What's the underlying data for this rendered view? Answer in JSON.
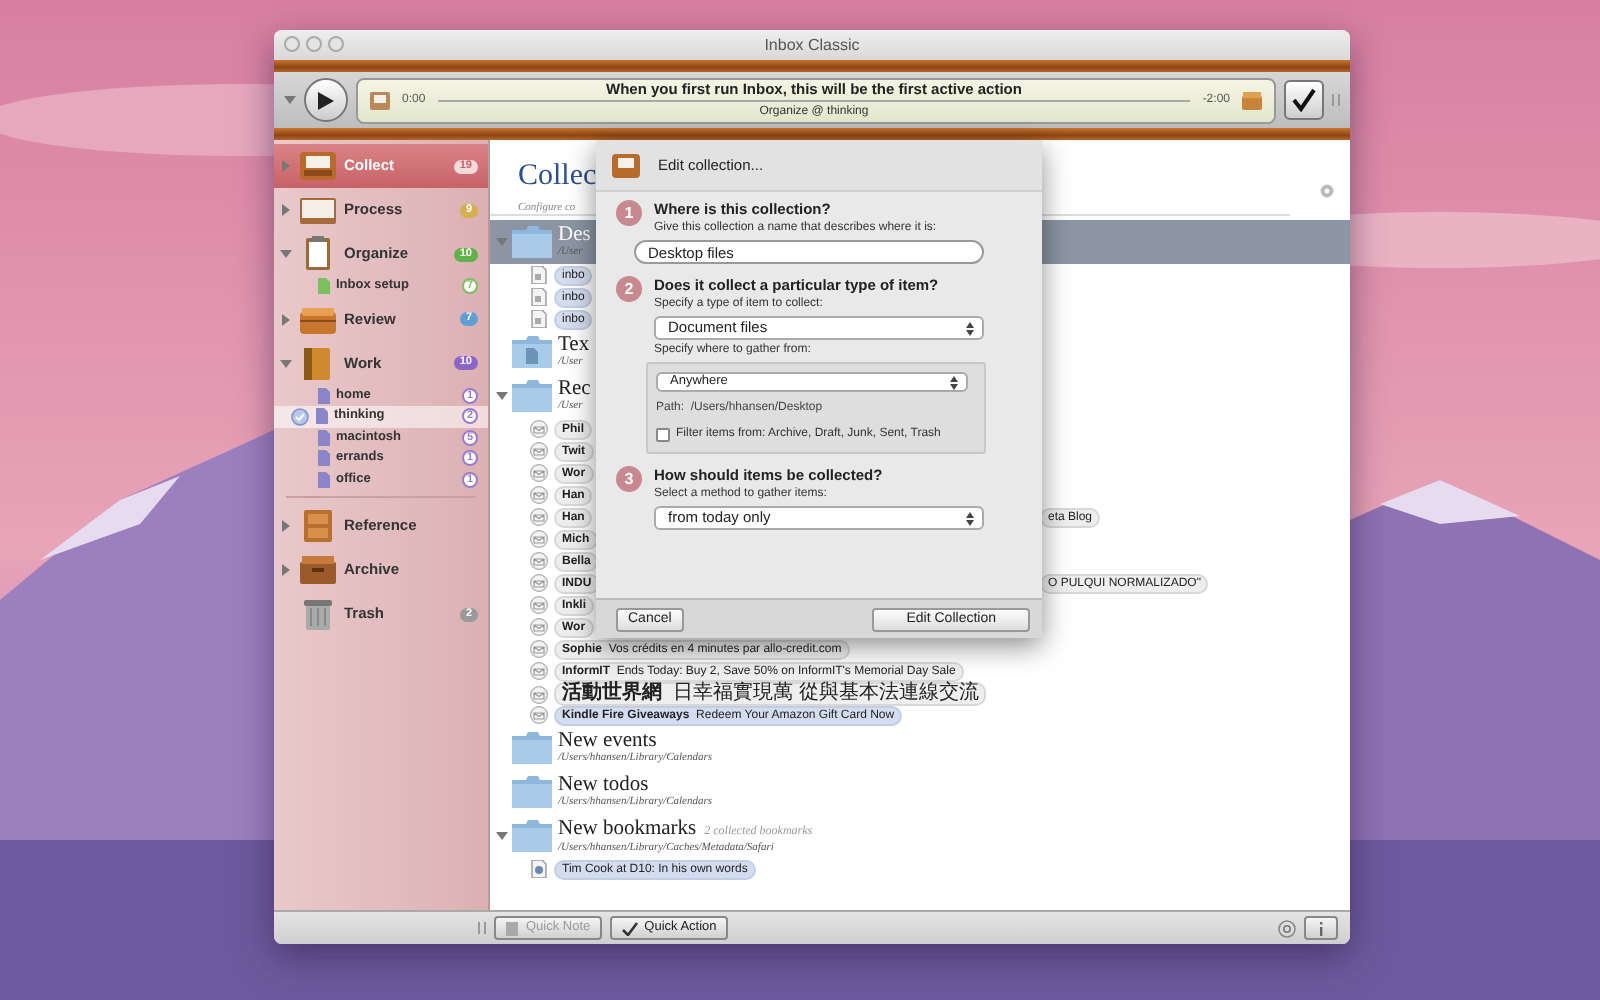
{
  "window": {
    "title": "Inbox Classic"
  },
  "player": {
    "elapsed": "0:00",
    "action": "When you first run Inbox, this will be the first active action",
    "context": "Organize @ thinking",
    "remaining": "-2:00"
  },
  "sidebar": {
    "items": [
      {
        "kind": "tray",
        "label": "Collect",
        "count": "19",
        "color": "#f4dada",
        "selected": true,
        "expanded": false
      },
      {
        "kind": "box",
        "label": "Process",
        "count": "9",
        "color": "#d4b04e",
        "selected": false,
        "expanded": false
      },
      {
        "kind": "clipboard",
        "label": "Organize",
        "count": "10",
        "color": "#62b04a",
        "selected": false,
        "expanded": true,
        "children": [
          {
            "label": "Inbox setup",
            "count": "7",
            "color": "#7cbf5e",
            "selected": false
          }
        ]
      },
      {
        "kind": "basket",
        "label": "Review",
        "count": "7",
        "color": "#5f9fd4",
        "selected": false,
        "expanded": false
      },
      {
        "kind": "binder",
        "label": "Work",
        "count": "10",
        "color": "#8a67c6",
        "selected": false,
        "expanded": true,
        "children": [
          {
            "label": "home",
            "count": "1",
            "color": "#9a7ccc",
            "selected": false
          },
          {
            "label": "thinking",
            "count": "2",
            "color": "#9a7ccc",
            "selected": true
          },
          {
            "label": "macintosh",
            "count": "5",
            "color": "#9a7ccc",
            "selected": false
          },
          {
            "label": "errands",
            "count": "1",
            "color": "#9a7ccc",
            "selected": false
          },
          {
            "label": "office",
            "count": "1",
            "color": "#9a7ccc",
            "selected": false
          }
        ]
      },
      {
        "kind": "cabinet",
        "label": "Reference",
        "selected": false,
        "expanded": false
      },
      {
        "kind": "crate",
        "label": "Archive",
        "selected": false,
        "expanded": false
      },
      {
        "kind": "bin",
        "label": "Trash",
        "count": "2",
        "color": "#9a9a9a",
        "selected": false
      }
    ]
  },
  "content": {
    "title": "Collec",
    "subtitle": "Configure co",
    "groups": [
      {
        "kind": "folder",
        "title": "Des",
        "path": "/User",
        "selected": true,
        "expanded": true,
        "items": [
          {
            "kind": "document",
            "sender": "inbo",
            "highlighted": true
          },
          {
            "kind": "document",
            "sender": "inbo",
            "highlighted": true
          },
          {
            "kind": "document",
            "sender": "inbo",
            "highlighted": true
          }
        ]
      },
      {
        "kind": "docfolder",
        "title": "Tex",
        "path": "/User",
        "selected": false,
        "expanded": false
      },
      {
        "kind": "folder",
        "title": "Rec",
        "path": "/User",
        "selected": false,
        "expanded": true,
        "items": [
          {
            "kind": "mail",
            "sender": "Phil",
            "highlighted": false
          },
          {
            "kind": "mail",
            "sender": "Twit",
            "highlighted": false
          },
          {
            "kind": "mail",
            "sender": "Wor",
            "highlighted": false
          },
          {
            "kind": "mail",
            "sender": "Han",
            "highlighted": false
          },
          {
            "kind": "mail",
            "sender": "Han",
            "tail": "eta Blog",
            "highlighted": false
          },
          {
            "kind": "mail",
            "sender": "Mich",
            "highlighted": false
          },
          {
            "kind": "mail",
            "sender": "Bella",
            "highlighted": false
          },
          {
            "kind": "mail",
            "sender": "INDU",
            "tail": "O PULQUI NORMALIZADO\"",
            "highlighted": false
          },
          {
            "kind": "mail",
            "sender": "Inkli",
            "highlighted": false
          },
          {
            "kind": "mail",
            "sender": "Wor",
            "highlighted": false
          },
          {
            "kind": "mail",
            "sender": "Sophie",
            "text": "Vos crédits en 4 minutes par allo-credit.com",
            "highlighted": false
          },
          {
            "kind": "mail",
            "sender": "InformIT",
            "text": "Ends Today: Buy 2, Save 50% on InformIT's Memorial Day Sale",
            "highlighted": false
          },
          {
            "kind": "mail",
            "sender": "活動世界網",
            "text": "日幸福實現萬 從與基本法連線交流",
            "highlighted": false
          },
          {
            "kind": "mail",
            "sender": "Kindle Fire Giveaways",
            "text": "Redeem Your Amazon Gift Card Now",
            "highlighted": true
          }
        ]
      },
      {
        "kind": "folder",
        "title": "New events",
        "path": "/Users/hhansen/Library/Calendars",
        "selected": false,
        "expanded": false
      },
      {
        "kind": "folder",
        "title": "New todos",
        "path": "/Users/hhansen/Library/Calendars",
        "selected": false,
        "expanded": false
      },
      {
        "kind": "folder",
        "title": "New bookmarks",
        "note": "2 collected bookmarks",
        "path": "/Users/hhansen/Library/Caches/Metadata/Safari",
        "selected": false,
        "expanded": true,
        "items": [
          {
            "kind": "bookmark",
            "sender": "Tim Cook at D10: In his own words",
            "highlighted": true
          }
        ]
      }
    ]
  },
  "dialog": {
    "title": "Edit collection...",
    "steps": [
      {
        "number": "1",
        "title": "Where is this collection?",
        "fields": [
          {
            "kind": "label",
            "text": "Give this collection a name that describes where it is:"
          },
          {
            "kind": "text",
            "value": "Desktop files"
          }
        ]
      },
      {
        "number": "2",
        "title": "Does it collect a particular type of item?",
        "fields": [
          {
            "kind": "label",
            "text": "Specify a type of item to collect:"
          },
          {
            "kind": "select",
            "value": "Document files"
          },
          {
            "kind": "label",
            "text": "Specify where to gather from:"
          },
          {
            "kind": "group",
            "fields": [
              {
                "kind": "select",
                "value": "Anywhere"
              },
              {
                "kind": "path",
                "label": "Path:",
                "value": "/Users/hhansen/Desktop"
              },
              {
                "kind": "checkbox",
                "label": "Filter items from: Archive, Draft, Junk, Sent, Trash",
                "checked": false
              }
            ]
          }
        ]
      },
      {
        "number": "3",
        "title": "How should items be collected?",
        "fields": [
          {
            "kind": "label",
            "text": "Select a method to gather items:"
          },
          {
            "kind": "select",
            "value": "from today only"
          }
        ]
      }
    ],
    "buttons": [
      "Cancel",
      "Edit Collection"
    ]
  },
  "bottom_bar": {
    "buttons": [
      {
        "label": "Quick Note",
        "disabled": true
      },
      {
        "label": "Quick Action",
        "disabled": false
      }
    ]
  }
}
